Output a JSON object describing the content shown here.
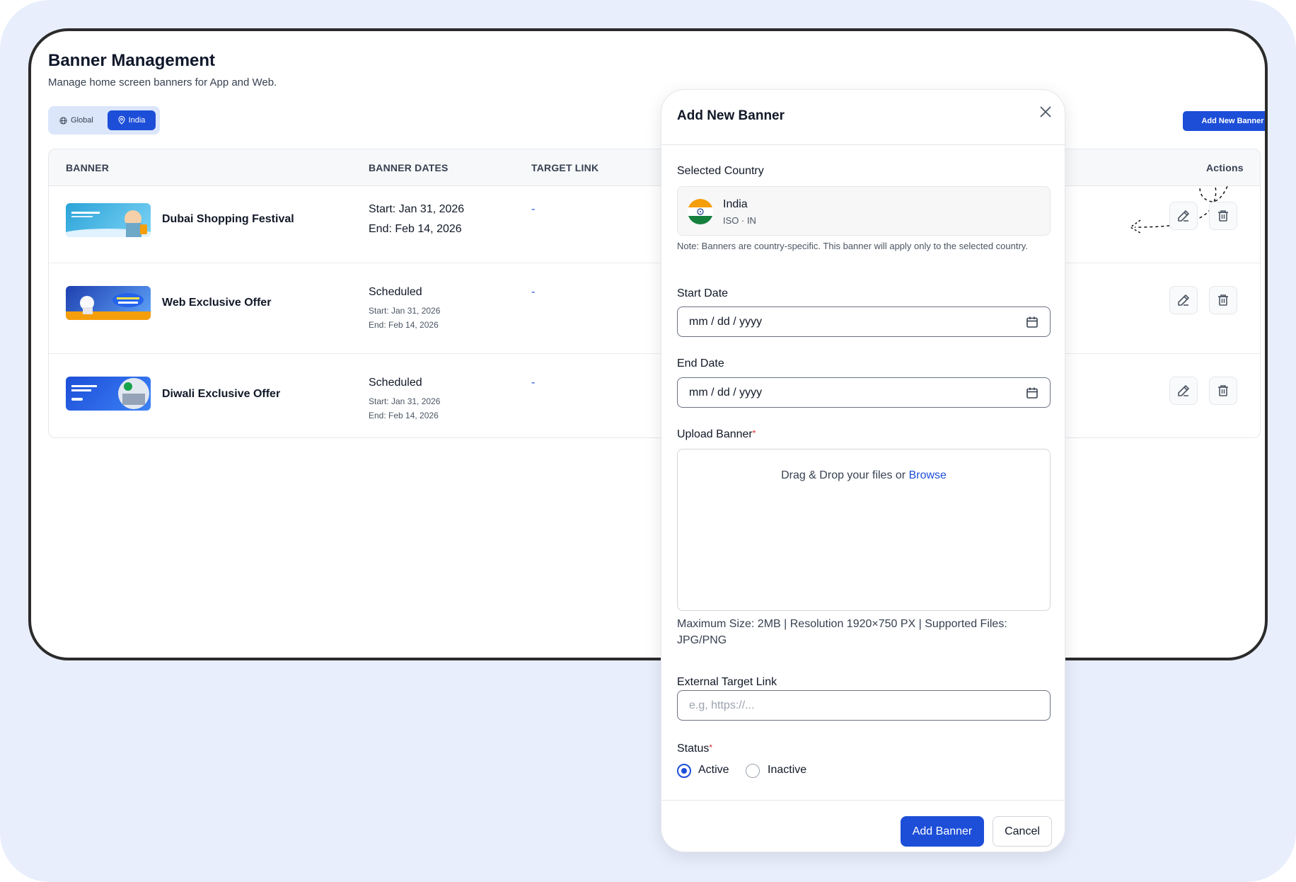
{
  "page": {
    "title": "Banner Management",
    "subtitle": "Manage home screen banners for App and Web.",
    "toggle": {
      "global_label": "Global",
      "india_label": "India",
      "selected": "India"
    },
    "add_button_label": "Add New Banner"
  },
  "table": {
    "columns": [
      "BANNER",
      "BANNER DATES",
      "TARGET LINK",
      "Actions"
    ],
    "rows": [
      {
        "name": "Dubai Shopping Festival",
        "status": "",
        "start": "Start: Jan 31, 2026",
        "end": "End: Feb 14, 2026",
        "link": "-"
      },
      {
        "name": "Web Exclusive Offer",
        "status": "Scheduled",
        "start": "Start: Jan 31, 2026",
        "end": "End: Feb 14, 2026",
        "link": "-"
      },
      {
        "name": "Diwali Exclusive Offer",
        "status": "Scheduled",
        "start": "Start: Jan 31, 2026",
        "end": "End: Feb 14, 2026",
        "link": "-"
      }
    ]
  },
  "modal": {
    "title": "Add New Banner",
    "selected_country_label": "Selected Country",
    "country": {
      "name": "India",
      "iso": "ISO · IN"
    },
    "note": "Note: Banners are country-specific. This banner will apply only to the selected country.",
    "start_date_label": "Start Date",
    "start_date_value": "mm / dd / yyyy",
    "end_date_label": "End Date",
    "end_date_value": "mm / dd / yyyy",
    "upload_label": "Upload Banner",
    "required_mark": "*",
    "drop_text": "Drag & Drop your files or",
    "browse_label": "Browse",
    "upload_hint": "Maximum Size: 2MB | Resolution 1920×750 PX | Supported Files: JPG/PNG",
    "target_link_label": "External Target Link",
    "target_link_placeholder": "e.g, https://...",
    "status_label": "Status",
    "status_options": [
      "Active",
      "Inactive"
    ],
    "status_selected": "Active",
    "submit_label": "Add Banner",
    "cancel_label": "Cancel"
  },
  "colors": {
    "accent": "#1d4ed8",
    "background": "#e8eefc"
  }
}
